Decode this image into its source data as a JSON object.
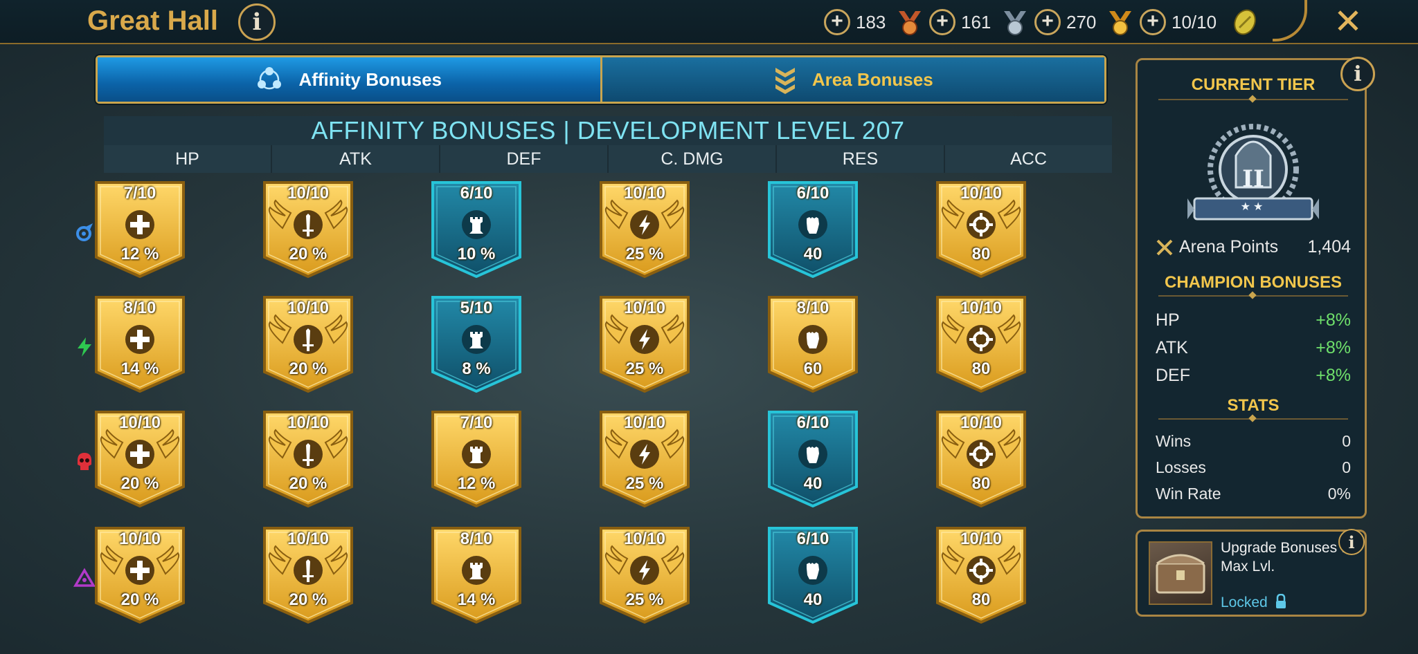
{
  "header": {
    "title": "Great Hall",
    "info_label": "i",
    "close_label": "✕",
    "resources": [
      {
        "value": "183",
        "icon": "bronze-medal-icon",
        "color": "#e07a2a"
      },
      {
        "value": "161",
        "icon": "silver-medal-icon",
        "color": "#9fb3c4"
      },
      {
        "value": "270",
        "icon": "gold-medal-icon",
        "color": "#e5a62a"
      },
      {
        "value": "10/10",
        "icon": "arena-token-icon",
        "color": "#d8c23a"
      }
    ],
    "plus_label": "+"
  },
  "tabs": [
    {
      "label": "Affinity Bonuses",
      "icon": "affinity-triad-icon",
      "active": true
    },
    {
      "label": "Area Bonuses",
      "icon": "area-chevrons-icon",
      "active": false
    }
  ],
  "grid": {
    "title": "AFFINITY BONUSES | DEVELOPMENT LEVEL 207",
    "columns": [
      "HP",
      "ATK",
      "DEF",
      "C. DMG",
      "RES",
      "ACC"
    ],
    "affinities": [
      {
        "name": "magic",
        "icon": "magic-affinity-icon",
        "color": "#3c8fe8"
      },
      {
        "name": "spirit",
        "icon": "spirit-affinity-icon",
        "color": "#2ec850"
      },
      {
        "name": "force",
        "icon": "force-affinity-icon",
        "color": "#e0303a"
      },
      {
        "name": "void",
        "icon": "void-affinity-icon",
        "color": "#b23ac8"
      }
    ],
    "rows": [
      [
        {
          "level": "7/10",
          "value": "12 %",
          "style": "gold",
          "winged": false
        },
        {
          "level": "10/10",
          "value": "20 %",
          "style": "gold",
          "winged": true
        },
        {
          "level": "6/10",
          "value": "10 %",
          "style": "teal",
          "winged": false
        },
        {
          "level": "10/10",
          "value": "25 %",
          "style": "gold",
          "winged": true
        },
        {
          "level": "6/10",
          "value": "40",
          "style": "teal",
          "winged": false
        },
        {
          "level": "10/10",
          "value": "80",
          "style": "gold",
          "winged": true
        }
      ],
      [
        {
          "level": "8/10",
          "value": "14 %",
          "style": "gold",
          "winged": false
        },
        {
          "level": "10/10",
          "value": "20 %",
          "style": "gold",
          "winged": true
        },
        {
          "level": "5/10",
          "value": "8 %",
          "style": "teal",
          "winged": false
        },
        {
          "level": "10/10",
          "value": "25 %",
          "style": "gold",
          "winged": true
        },
        {
          "level": "8/10",
          "value": "60",
          "style": "gold",
          "winged": false
        },
        {
          "level": "10/10",
          "value": "80",
          "style": "gold",
          "winged": true
        }
      ],
      [
        {
          "level": "10/10",
          "value": "20 %",
          "style": "gold",
          "winged": true
        },
        {
          "level": "10/10",
          "value": "20 %",
          "style": "gold",
          "winged": true
        },
        {
          "level": "7/10",
          "value": "12 %",
          "style": "gold",
          "winged": false
        },
        {
          "level": "10/10",
          "value": "25 %",
          "style": "gold",
          "winged": true
        },
        {
          "level": "6/10",
          "value": "40",
          "style": "teal",
          "winged": false
        },
        {
          "level": "10/10",
          "value": "80",
          "style": "gold",
          "winged": true
        }
      ],
      [
        {
          "level": "10/10",
          "value": "20 %",
          "style": "gold",
          "winged": true
        },
        {
          "level": "10/10",
          "value": "20 %",
          "style": "gold",
          "winged": true
        },
        {
          "level": "8/10",
          "value": "14 %",
          "style": "gold",
          "winged": false
        },
        {
          "level": "10/10",
          "value": "25 %",
          "style": "gold",
          "winged": true
        },
        {
          "level": "6/10",
          "value": "40",
          "style": "teal",
          "winged": false
        },
        {
          "level": "10/10",
          "value": "80",
          "style": "gold",
          "winged": true
        }
      ]
    ],
    "column_emblems": [
      "hp-cross-icon",
      "atk-sword-icon",
      "def-tower-icon",
      "cdmg-lightning-icon",
      "res-fist-icon",
      "acc-crosshair-icon"
    ]
  },
  "side_panel": {
    "current_tier_label": "CURRENT TIER",
    "tier_numeral": "II",
    "arena_points_label": "Arena Points",
    "arena_points_value": "1,404",
    "champion_bonuses_label": "CHAMPION BONUSES",
    "champion_bonuses": [
      {
        "stat": "HP",
        "value": "+8%"
      },
      {
        "stat": "ATK",
        "value": "+8%"
      },
      {
        "stat": "DEF",
        "value": "+8%"
      }
    ],
    "stats_label": "STATS",
    "stats": [
      {
        "stat": "Wins",
        "value": "0"
      },
      {
        "stat": "Losses",
        "value": "0"
      },
      {
        "stat": "Win Rate",
        "value": "0%"
      }
    ]
  },
  "upgrade": {
    "text": "Upgrade Bonuses to Max Lvl.",
    "status": "Locked"
  },
  "colors": {
    "gold": "#e9b22d",
    "teal": "#16607a",
    "accent_gold": "#f2c64c",
    "title_cyan": "#7fe3f2",
    "positive_green": "#6fe06b"
  }
}
